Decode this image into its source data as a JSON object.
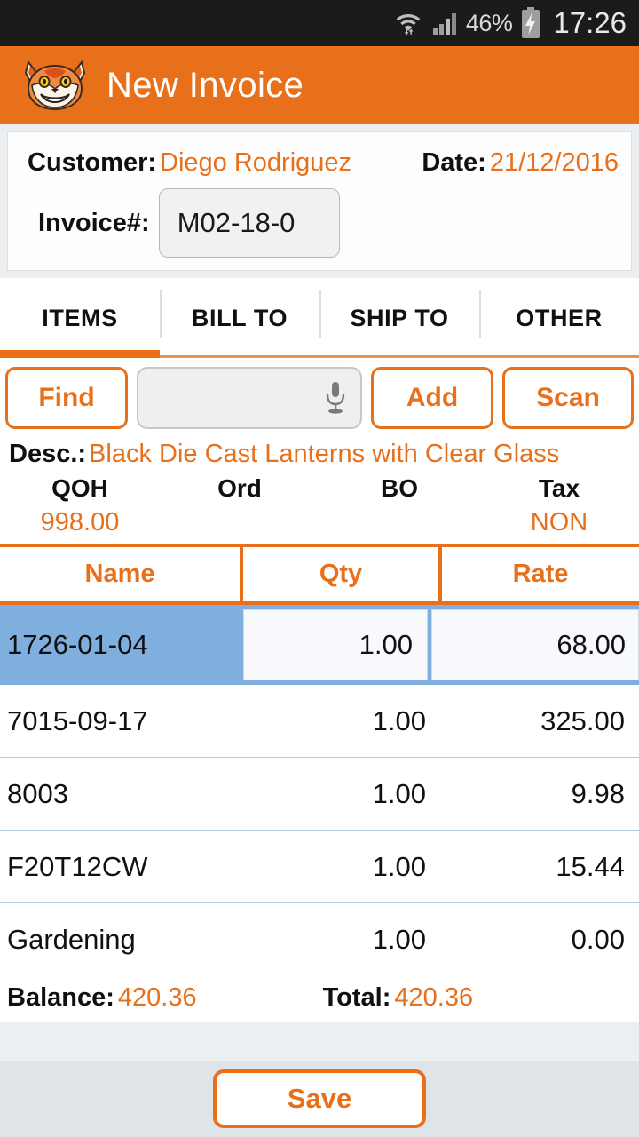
{
  "status_bar": {
    "wifi_icon": "wifi-data-icon",
    "signal_icon": "cellular-signal-icon",
    "battery_percent": "46%",
    "battery_icon": "battery-charging-icon",
    "clock": "17:26"
  },
  "app_bar": {
    "logo_icon": "fox-logo-icon",
    "title": "New Invoice"
  },
  "customer_card": {
    "customer_label": "Customer:",
    "customer_value": "Diego Rodriguez",
    "date_label": "Date:",
    "date_value": "21/12/2016",
    "invoice_label": "Invoice#:",
    "invoice_value": "M02-18-0",
    "invoice_placeholder": ""
  },
  "tabs": [
    {
      "label": "ITEMS",
      "active": true
    },
    {
      "label": "BILL TO",
      "active": false
    },
    {
      "label": "SHIP TO",
      "active": false
    },
    {
      "label": "OTHER",
      "active": false
    }
  ],
  "actions": {
    "find_label": "Find",
    "search_value": "",
    "search_placeholder": "",
    "mic_icon": "microphone-icon",
    "add_label": "Add",
    "scan_label": "Scan"
  },
  "description": {
    "label": "Desc.:",
    "value": "Black Die Cast Lanterns with Clear Glass"
  },
  "stock_info": {
    "headers": [
      "QOH",
      "Ord",
      "BO",
      "Tax"
    ],
    "values": [
      "998.00",
      "",
      "",
      "NON"
    ]
  },
  "item_table": {
    "columns": [
      "Name",
      "Qty",
      "Rate"
    ],
    "rows": [
      {
        "name": "1726-01-04",
        "qty": "1.00",
        "rate": "68.00",
        "selected": true
      },
      {
        "name": "7015-09-17",
        "qty": "1.00",
        "rate": "325.00",
        "selected": false
      },
      {
        "name": "8003",
        "qty": "1.00",
        "rate": "9.98",
        "selected": false
      },
      {
        "name": "F20T12CW",
        "qty": "1.00",
        "rate": "15.44",
        "selected": false
      },
      {
        "name": "Gardening",
        "qty": "1.00",
        "rate": "0.00",
        "selected": false
      }
    ]
  },
  "totals": {
    "balance_label": "Balance:",
    "balance_value": "420.36",
    "total_label": "Total:",
    "total_value": "420.36"
  },
  "bottom_bar": {
    "save_label": "Save"
  },
  "colors": {
    "accent": "#e8701a",
    "selected_row": "#7fafdf",
    "status_bar": "#1b1b1b",
    "bottom_bar": "#dfe4e8"
  }
}
